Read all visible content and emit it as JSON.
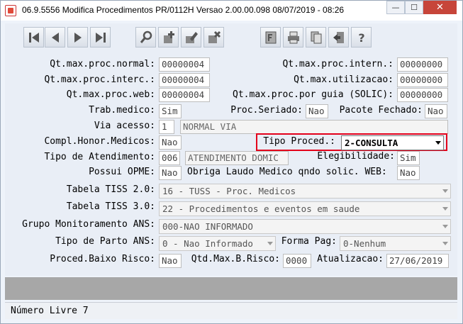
{
  "window": {
    "title": "06.9.5556  Modifica  Procedimentos PR/0112H Versao 2.00.00.098 08/07/2019 - 08:26",
    "minimize_label": "—",
    "maximize_label": "☐",
    "close_label": "✕"
  },
  "toolbar": {
    "icons": [
      "first-record-icon",
      "previous-record-icon",
      "next-record-icon",
      "last-record-icon",
      "search-icon",
      "add-icon",
      "edit-icon",
      "delete-icon",
      "filter-icon",
      "print-icon",
      "copy-icon",
      "exit-icon",
      "help-icon"
    ]
  },
  "form": {
    "qt_max_proc_normal": {
      "label": "Qt.max.proc.normal:",
      "value": "00000004"
    },
    "qt_max_proc_intern": {
      "label": "Qt.max.proc.intern.:",
      "value": "00000000"
    },
    "qt_max_proc_interc": {
      "label": "Qt.max.proc.interc.:",
      "value": "00000004"
    },
    "qt_max_utilizacao": {
      "label": "Qt.max.utilizacao:",
      "value": "00000000"
    },
    "qt_max_proc_web": {
      "label": "Qt.max.proc.web:",
      "value": "00000004"
    },
    "qt_max_proc_guia": {
      "label": "Qt.max.proc.por guia (SOLIC):",
      "value": "00000000"
    },
    "trab_medico": {
      "label": "Trab.medico:",
      "value": "Sim"
    },
    "proc_seriado": {
      "label": "Proc.Seriado:",
      "value": "Nao"
    },
    "pacote_fechado": {
      "label": "Pacote Fechado:",
      "value": "Nao"
    },
    "via_acesso": {
      "label": "Via acesso:",
      "code": "1",
      "description": "NORMAL VIA"
    },
    "compl_honor_medicos": {
      "label": "Compl.Honor.Medicos:",
      "value": "Nao"
    },
    "tipo_proced": {
      "label": "Tipo Proced.:",
      "value": "2-CONSULTA"
    },
    "tipo_atendimento": {
      "label": "Tipo de Atendimento:",
      "code": "006",
      "description": "ATENDIMENTO DOMIC"
    },
    "elegibilidade": {
      "label": "Elegibilidade:",
      "value": "Sim"
    },
    "possui_opme": {
      "label": "Possui OPME:",
      "value": "Nao"
    },
    "obriga_laudo": {
      "label": "Obriga Laudo Medico qndo solic. WEB:",
      "value": "Nao"
    },
    "tabela_tiss_20": {
      "label": "Tabela TISS 2.0:",
      "value": "16 - TUSS - Proc. Medicos"
    },
    "tabela_tiss_30": {
      "label": "Tabela TISS 3.0:",
      "value": "22 - Procedimentos e eventos em saude"
    },
    "grupo_monitoramento": {
      "label": "Grupo Monitoramento ANS:",
      "value": "000-NAO INFORMADO"
    },
    "tipo_parto": {
      "label": "Tipo de Parto ANS:",
      "value": "0 - Nao Informado"
    },
    "forma_pag": {
      "label": "Forma Pag:",
      "value": "0-Nenhum"
    },
    "proced_baixo_risco": {
      "label": "Proced.Baixo Risco:",
      "value": "Nao"
    },
    "qtd_max_b_risco": {
      "label": "Qtd.Max.B.Risco:",
      "value": "0000"
    },
    "atualizacao": {
      "label": "Atualizacao:",
      "value": "27/06/2019"
    }
  },
  "status": {
    "text": "Número Livre 7"
  },
  "colors": {
    "highlight_border": "#e3001b",
    "form_background": "#e9eef6",
    "gray_bar": "#a7a7a7"
  }
}
